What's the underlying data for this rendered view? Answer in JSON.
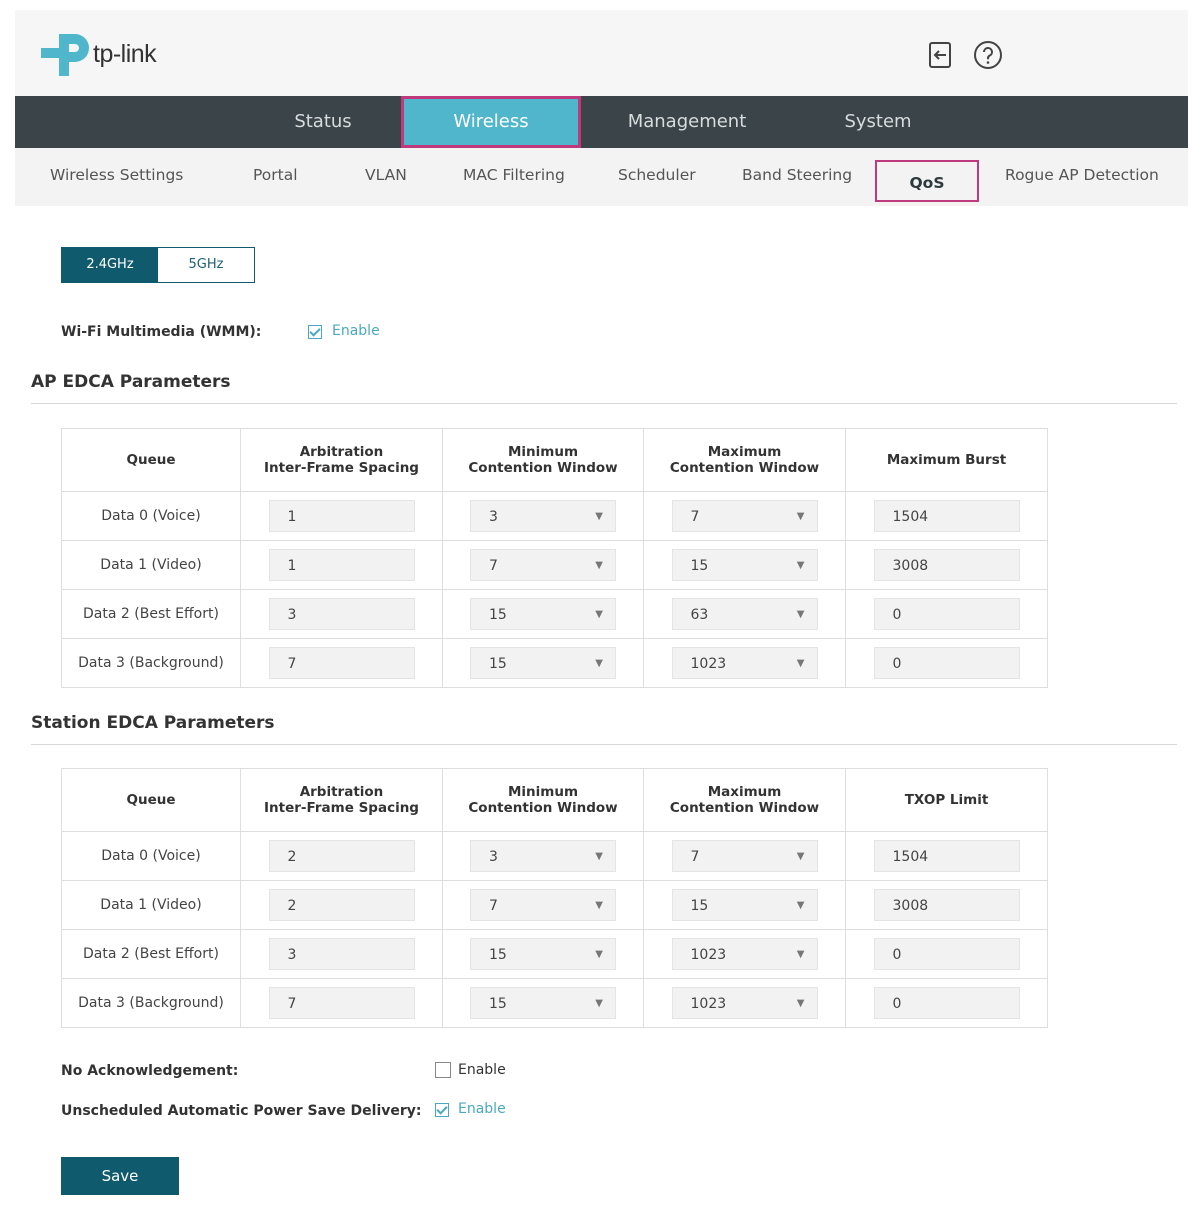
{
  "brand": {
    "logo_text": "tp-link",
    "accent": "#0f5a6c",
    "highlight": "#c0397c",
    "tab_active": "#4fb6cc"
  },
  "header": {
    "logout_icon": "logout-icon",
    "help_icon": "help-icon"
  },
  "main_tabs": [
    "Status",
    "Wireless",
    "Management",
    "System"
  ],
  "active_main_tab": "Wireless",
  "sub_tabs": [
    "Wireless Settings",
    "Portal",
    "VLAN",
    "MAC Filtering",
    "Scheduler",
    "Band Steering",
    "QoS",
    "Rogue AP Detection"
  ],
  "active_sub_tab": "QoS",
  "band": {
    "options": [
      "2.4GHz",
      "5GHz"
    ],
    "selected": "2.4GHz"
  },
  "wmm": {
    "label": "Wi-Fi Multimedia (WMM):",
    "checkbox_label": "Enable",
    "checked": true
  },
  "ap_edca": {
    "title": "AP EDCA Parameters",
    "headers": [
      "Queue",
      "Arbitration\nInter-Frame Spacing",
      "Minimum\nContention Window",
      "Maximum\nContention Window",
      "Maximum Burst"
    ],
    "rows": [
      {
        "queue": "Data 0 (Voice)",
        "aifs": "1",
        "cwmin": "3",
        "cwmax": "7",
        "last": "1504"
      },
      {
        "queue": "Data 1 (Video)",
        "aifs": "1",
        "cwmin": "7",
        "cwmax": "15",
        "last": "3008"
      },
      {
        "queue": "Data 2 (Best Effort)",
        "aifs": "3",
        "cwmin": "15",
        "cwmax": "63",
        "last": "0"
      },
      {
        "queue": "Data 3 (Background)",
        "aifs": "7",
        "cwmin": "15",
        "cwmax": "1023",
        "last": "0"
      }
    ]
  },
  "station_edca": {
    "title": "Station EDCA Parameters",
    "headers": [
      "Queue",
      "Arbitration\nInter-Frame Spacing",
      "Minimum\nContention Window",
      "Maximum\nContention Window",
      "TXOP Limit"
    ],
    "rows": [
      {
        "queue": "Data 0 (Voice)",
        "aifs": "2",
        "cwmin": "3",
        "cwmax": "7",
        "last": "1504"
      },
      {
        "queue": "Data 1 (Video)",
        "aifs": "2",
        "cwmin": "7",
        "cwmax": "15",
        "last": "3008"
      },
      {
        "queue": "Data 2 (Best Effort)",
        "aifs": "3",
        "cwmin": "15",
        "cwmax": "1023",
        "last": "0"
      },
      {
        "queue": "Data 3 (Background)",
        "aifs": "7",
        "cwmin": "15",
        "cwmax": "1023",
        "last": "0"
      }
    ]
  },
  "no_ack": {
    "label": "No Acknowledgement:",
    "checkbox_label": "Enable",
    "checked": false
  },
  "uapsd": {
    "label": "Unscheduled Automatic Power Save Delivery:",
    "checkbox_label": "Enable",
    "checked": true
  },
  "save_label": "Save"
}
